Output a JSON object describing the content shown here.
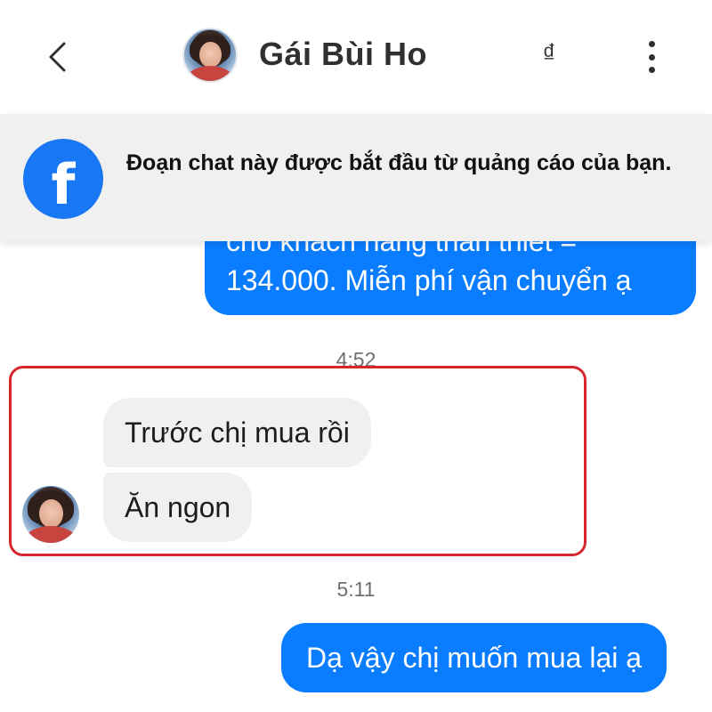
{
  "header": {
    "contact_name": "Gái Bùi Ho",
    "currency_symbol": "₫"
  },
  "ad_banner": {
    "text": "Đoạn chat này được bắt đầu từ quảng cáo của bạn.",
    "logo_letter": "f"
  },
  "messages": [
    {
      "direction": "outgoing",
      "lines": [
        "cho khách hàng thân thiết =",
        "134.000. Miễn phí vận chuyển ạ"
      ]
    },
    {
      "type": "timestamp",
      "text": "4:52"
    },
    {
      "direction": "incoming",
      "text": "Trước chị mua rồi"
    },
    {
      "direction": "incoming",
      "text": "Ăn ngon"
    },
    {
      "type": "timestamp",
      "text": "5:11"
    },
    {
      "direction": "outgoing",
      "text": "Dạ vậy chị muốn mua lại ạ"
    }
  ],
  "colors": {
    "outgoing_bubble": "#0a7cff",
    "incoming_bubble": "#f0f0f0",
    "facebook_blue": "#1877f2",
    "highlight_border": "#d7262f"
  }
}
